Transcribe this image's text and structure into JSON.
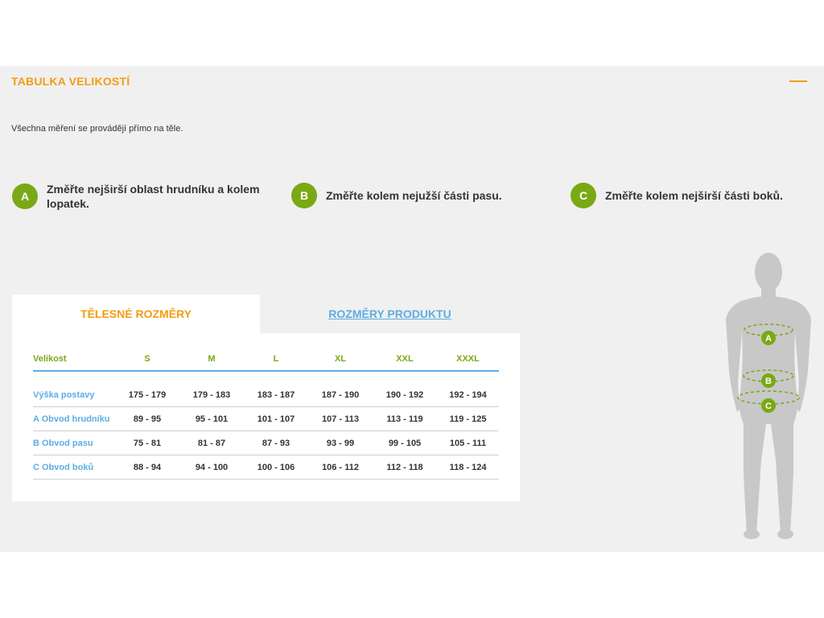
{
  "section": {
    "title": "TABULKA VELIKOSTÍ",
    "intro": "Všechna měření se provádějí přímo na těle."
  },
  "steps": [
    {
      "letter": "A",
      "text_line1": "Změřte nejširší oblast hrudníku a kolem",
      "text_line2": "lopatek."
    },
    {
      "letter": "B",
      "text": "Změřte kolem nejužší části pasu."
    },
    {
      "letter": "C",
      "text": "Změřte kolem nejširší části boků."
    }
  ],
  "tabs": {
    "body": "TĚLESNÉ ROZMĚRY",
    "product": "ROZMĚRY PRODUKTU"
  },
  "table": {
    "headers": [
      "Velikost",
      "S",
      "M",
      "L",
      "XL",
      "XXL",
      "XXXL"
    ],
    "rows": [
      {
        "label": "Výška postavy",
        "values": [
          "175 - 179",
          "179 - 183",
          "183 - 187",
          "187 - 190",
          "190 - 192",
          "192 - 194"
        ]
      },
      {
        "label": "A Obvod hrudníku",
        "values": [
          "89 - 95",
          "95 - 101",
          "101 - 107",
          "107 - 113",
          "113 - 119",
          "119 - 125"
        ]
      },
      {
        "label": "B Obvod pasu",
        "values": [
          "75 - 81",
          "81 - 87",
          "87 - 93",
          "93 - 99",
          "99 - 105",
          "105 - 111"
        ]
      },
      {
        "label": "C Obvod boků",
        "values": [
          "88 - 94",
          "94 - 100",
          "100 - 106",
          "106 - 112",
          "112 - 118",
          "118 - 124"
        ]
      }
    ]
  },
  "figure": {
    "markers": [
      "A",
      "B",
      "C"
    ]
  },
  "colors": {
    "accent_orange": "#f39c12",
    "accent_green": "#7aa915",
    "link_blue": "#5dade2",
    "panel_bg": "#f0f0f0",
    "silhouette": "#c8c8c8"
  }
}
